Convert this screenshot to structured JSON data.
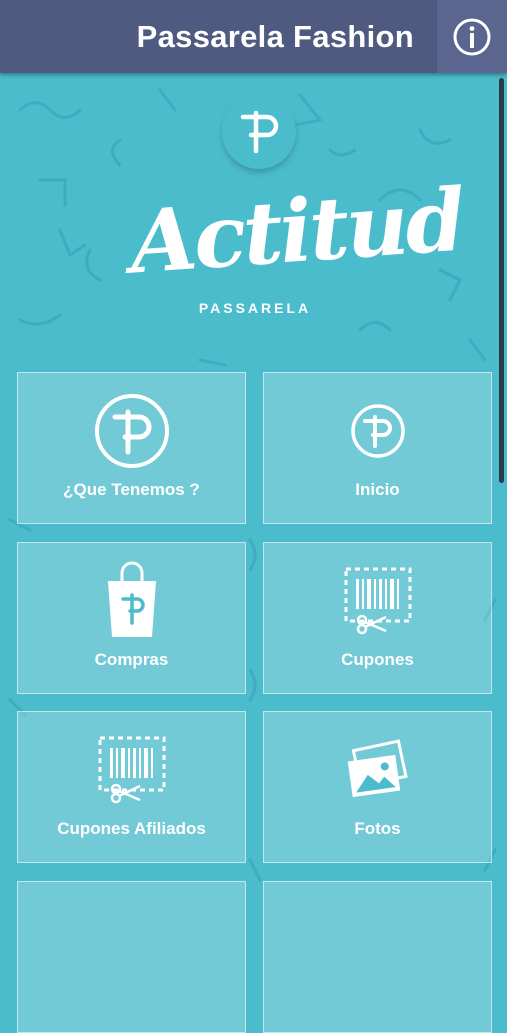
{
  "header": {
    "title": "Passarela Fashion"
  },
  "brand": {
    "word": "Actitud",
    "sub": "PASSARELA"
  },
  "tiles": [
    {
      "label": "¿Que Tenemos ?"
    },
    {
      "label": "Inicio"
    },
    {
      "label": "Compras"
    },
    {
      "label": "Cupones"
    },
    {
      "label": "Cupones Afiliados"
    },
    {
      "label": "Fotos"
    }
  ],
  "colors": {
    "header": "#4e5a80",
    "background": "#4bbccc",
    "tile": "rgba(255,255,255,0.22)"
  }
}
